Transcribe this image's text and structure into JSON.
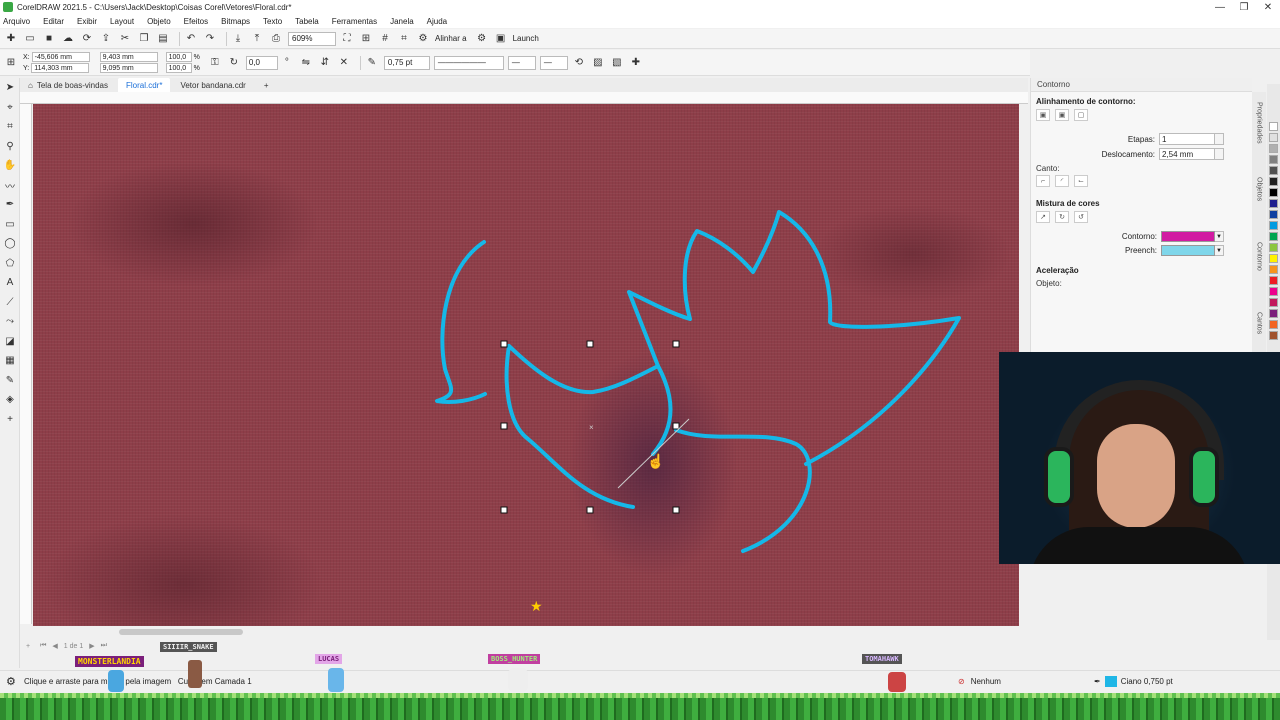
{
  "window": {
    "title": "CorelDRAW 2021.5 - C:\\Users\\Jack\\Desktop\\Coisas Corel\\Vetores\\Floral.cdr*",
    "minimize": "—",
    "restore": "❐",
    "close": "✕"
  },
  "menu": [
    "Arquivo",
    "Editar",
    "Exibir",
    "Layout",
    "Objeto",
    "Efeitos",
    "Bitmaps",
    "Texto",
    "Tabela",
    "Ferramentas",
    "Janela",
    "Ajuda"
  ],
  "toolbar": {
    "zoom": "609%",
    "align_label": "Alinhar a",
    "launch_label": "Launch"
  },
  "property_bar": {
    "x_label": "X:",
    "x_value": "-45,606 mm",
    "y_label": "Y:",
    "y_value": "114,303 mm",
    "w_value": "9,403 mm",
    "h_value": "9,095 mm",
    "scale_x": "100,0",
    "scale_y": "100,0",
    "percent": "%",
    "rotation": "0,0",
    "outline_width": "0,75 pt"
  },
  "doc_tabs": [
    "Tela de boas-vindas",
    "Floral.cdr*",
    "Vetor bandana.cdr"
  ],
  "active_tab": 1,
  "page_nav": {
    "label": "1 de 1"
  },
  "status": {
    "hint": "Clique e arraste para mover pela imagem",
    "layer": "Curva em Camada 1",
    "fill": "Nenhum",
    "outline": "Ciano 0,750 pt",
    "outline_color": "#1fb6e6"
  },
  "docker": {
    "title": "Contorno",
    "align_section": "Alinhamento de contorno:",
    "steps_label": "Etapas:",
    "steps_value": "1",
    "offset_label": "Deslocamento:",
    "offset_value": "2,54 mm",
    "corner_label": "Canto:",
    "color_mix_section": "Mistura de cores",
    "outline_label": "Contorno:",
    "outline_color": "#d11ba2",
    "fill_label": "Preench:",
    "fill_color": "#7fd6ea",
    "accel_section": "Aceleração",
    "object_label": "Objeto:"
  },
  "side_tabs": [
    "Propriedades",
    "Objetos",
    "Contorno",
    "Cantos"
  ],
  "palette": [
    "#ffffff",
    "#e0e0e0",
    "#b0b0b0",
    "#808080",
    "#505050",
    "#202020",
    "#000000",
    "#1f1f8f",
    "#0d3ea0",
    "#009be0",
    "#00a651",
    "#8cc63f",
    "#fff200",
    "#f7941d",
    "#ed1c24",
    "#ec008c",
    "#c2185b",
    "#7b1f7b",
    "#f26522",
    "#a0522d"
  ],
  "stream_overlay": {
    "badges": [
      "MONSTERLANDIA",
      "SIIIIR_SNAKE",
      "LUCAS",
      "BOSS_HUNTER",
      "TOMAHAWK"
    ]
  }
}
